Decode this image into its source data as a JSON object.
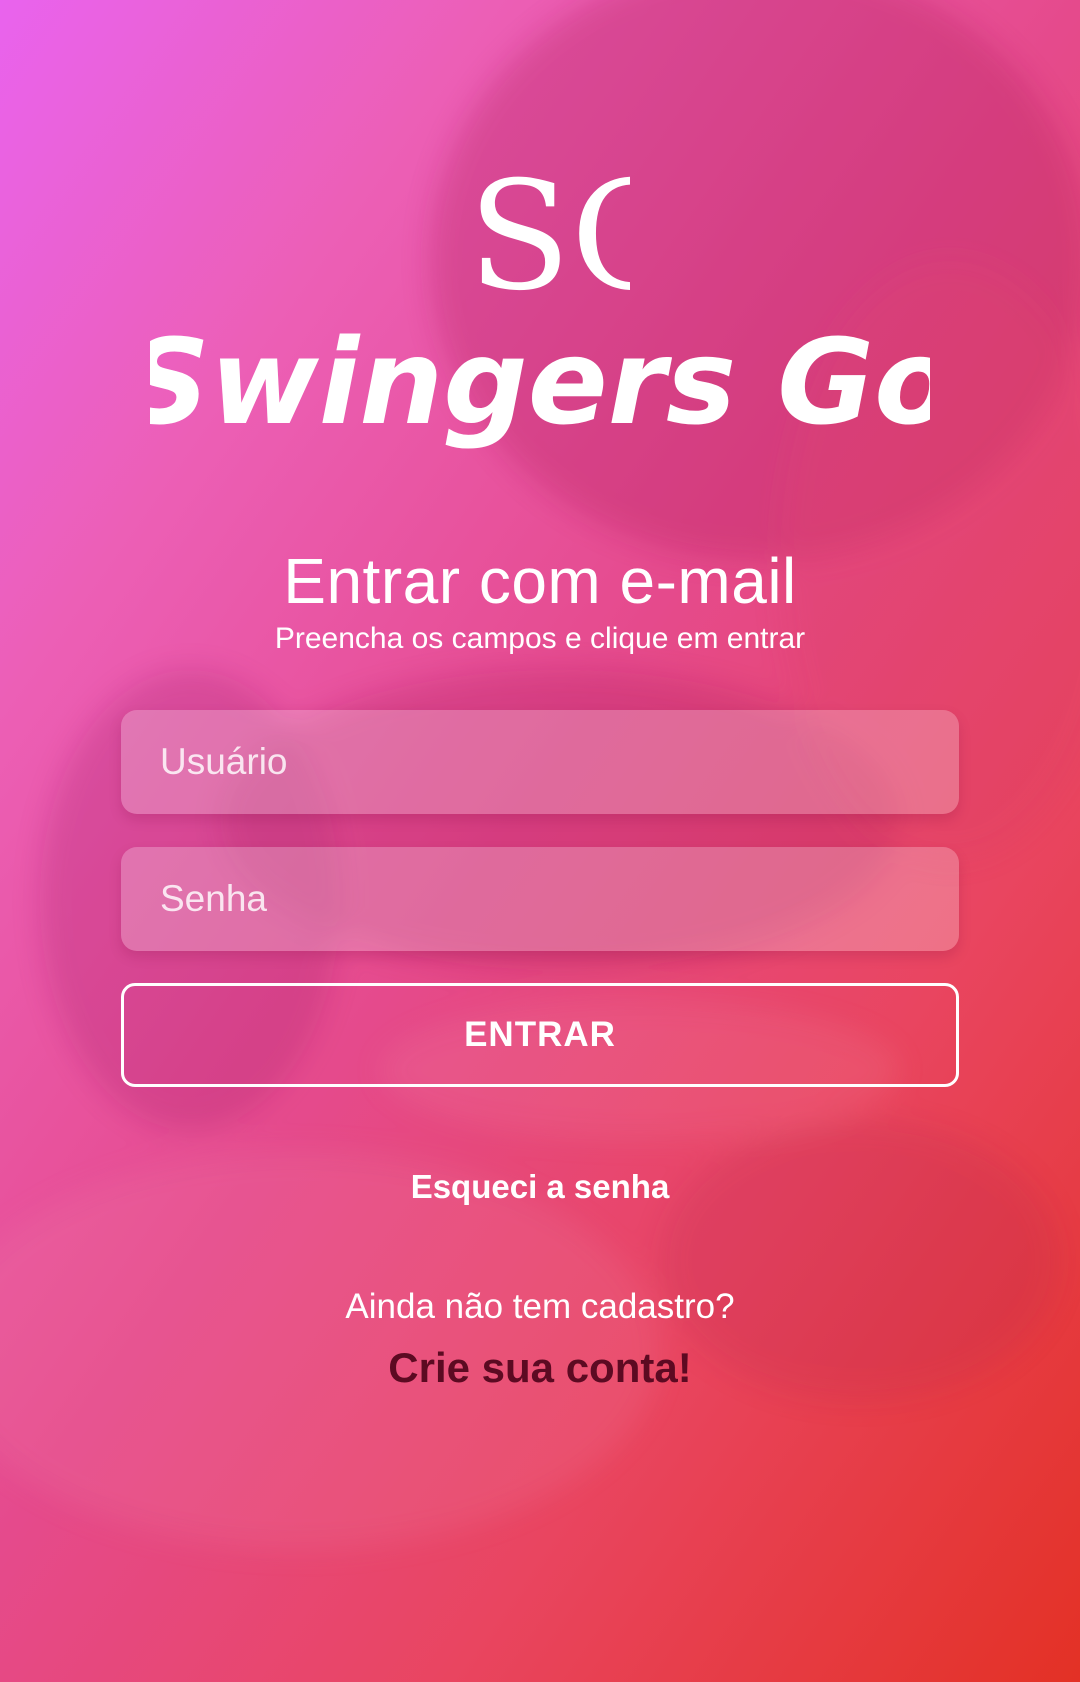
{
  "brand": {
    "monogram": "SG",
    "name": "Swingers Go"
  },
  "login": {
    "title": "Entrar com e-mail",
    "subtitle": "Preencha os campos e clique em entrar",
    "username_placeholder": "Usuário",
    "username_value": "",
    "password_placeholder": "Senha",
    "password_value": "",
    "submit_label": "ENTRAR",
    "forgot_password_label": "Esqueci a senha",
    "no_account_text": "Ainda não tem cadastro?",
    "create_account_label": "Crie sua conta!"
  },
  "colors": {
    "gradient_start": "#e963ee",
    "gradient_end": "#e33125",
    "text": "#ffffff",
    "create_account": "#5c0a22"
  }
}
